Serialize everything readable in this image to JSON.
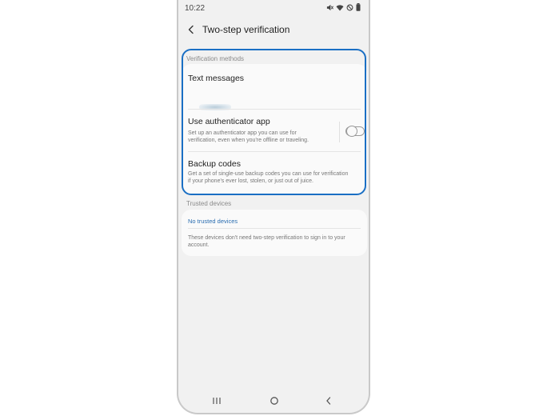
{
  "status_bar": {
    "time": "10:22",
    "icons": [
      "mute-icon",
      "wifi-icon",
      "do-not-disturb-icon",
      "battery-icon"
    ]
  },
  "header": {
    "back_icon": "back-arrow-icon",
    "title": "Two-step verification"
  },
  "verification_methods": {
    "section_label": "Verification methods",
    "items": [
      {
        "title": "Text messages",
        "value": ""
      },
      {
        "title": "Use authenticator app",
        "description_line1": "Set up an authenticator app you can use for",
        "description_line2": "verification, even when you're offline or traveling.",
        "toggle_on": false
      },
      {
        "title": "Backup codes",
        "description_line1": "Get a set of single-use backup codes you can use for verification",
        "description_line2": "if your phone's ever lost, stolen, or just out of juice."
      }
    ]
  },
  "trusted_devices": {
    "section_label": "Trusted devices",
    "link": "No trusted devices",
    "description_line1": "These devices don't need two-step verification to sign in to your",
    "description_line2": "account."
  },
  "nav_bar": {
    "icons": [
      "recent-apps-icon",
      "home-icon",
      "back-icon"
    ]
  },
  "colors": {
    "highlight": "#1a6fc4",
    "link": "#2a6db0",
    "background": "#f1f1f1",
    "card": "#fafafa"
  }
}
